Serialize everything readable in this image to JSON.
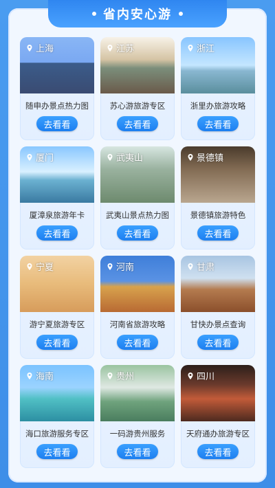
{
  "header": {
    "title": "省内安心游"
  },
  "cards": [
    {
      "location": "上海",
      "title": "随申办景点热力图",
      "button": "去看看"
    },
    {
      "location": "江苏",
      "title": "苏心游旅游专区",
      "button": "去看看"
    },
    {
      "location": "浙江",
      "title": "浙里办旅游攻略",
      "button": "去看看"
    },
    {
      "location": "厦门",
      "title": "厦漳泉旅游年卡",
      "button": "去看看"
    },
    {
      "location": "武夷山",
      "title": "武夷山景点热力图",
      "button": "去看看"
    },
    {
      "location": "景德镇",
      "title": "景德镇旅游特色",
      "button": "去看看"
    },
    {
      "location": "宁夏",
      "title": "游宁夏旅游专区",
      "button": "去看看"
    },
    {
      "location": "河南",
      "title": "河南省旅游攻略",
      "button": "去看看"
    },
    {
      "location": "甘肃",
      "title": "甘快办景点查询",
      "button": "去看看"
    },
    {
      "location": "海南",
      "title": "海口旅游服务专区",
      "button": "去看看"
    },
    {
      "location": "贵州",
      "title": "一码游贵州服务",
      "button": "去看看"
    },
    {
      "location": "四川",
      "title": "天府通办旅游专区",
      "button": "去看看"
    }
  ]
}
